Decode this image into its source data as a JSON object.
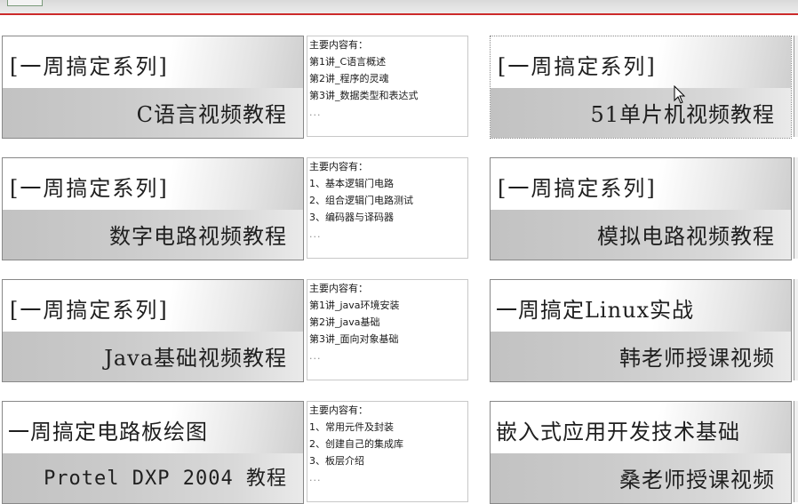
{
  "courses": [
    {
      "line1": "[一周搞定系列]",
      "line2": "C语言视频教程",
      "desc": {
        "heading": "主要内容有：",
        "lines": [
          "第1讲_C语言概述",
          "第2讲_程序的灵魂",
          "第3讲_数据类型和表达式"
        ],
        "more": "..."
      }
    },
    {
      "line1": "[一周搞定系列]",
      "line2": "51单片机视频教程"
    },
    {
      "line1": "[一周搞定系列]",
      "line2": "数字电路视频教程",
      "desc": {
        "heading": "主要内容有：",
        "lines": [
          "1、基本逻辑门电路",
          "2、组合逻辑门电路测试",
          "3、编码器与译码器"
        ],
        "more": "..."
      }
    },
    {
      "line1": "[一周搞定系列]",
      "line2": "模拟电路视频教程"
    },
    {
      "line1": "[一周搞定系列]",
      "line2": "Java基础视频教程",
      "desc": {
        "heading": "主要内容有：",
        "lines": [
          "第1讲_java环境安装",
          "第2讲_java基础",
          "第3讲_面向对象基础"
        ],
        "more": "..."
      }
    },
    {
      "line1": "一周搞定Linux实战",
      "line2": "韩老师授课视频"
    },
    {
      "line1": "一周搞定电路板绘图",
      "line2": "Protel DXP 2004 教程",
      "desc": {
        "heading": "主要内容有：",
        "lines": [
          "1、常用元件及封装",
          "2、创建自己的集成库",
          "3、板层介绍"
        ],
        "more": "..."
      }
    },
    {
      "line1": "嵌入式应用开发技术基础",
      "line2": "桑老师授课视频"
    }
  ]
}
